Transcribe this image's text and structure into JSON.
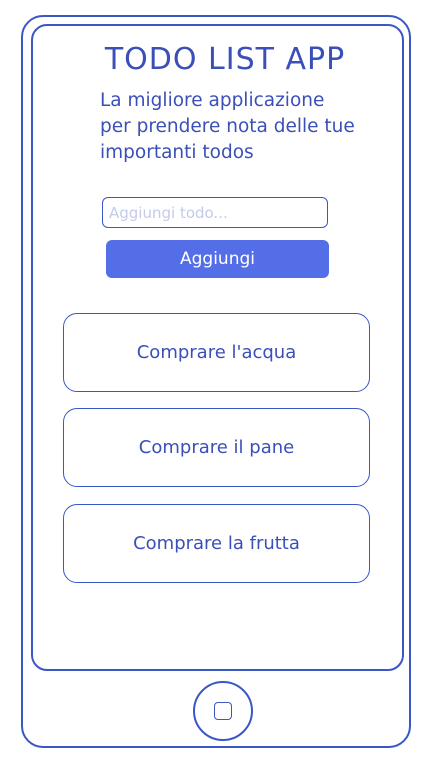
{
  "header": {
    "title": "TODO LIST APP",
    "subtitle": "La migliore applicazione per prendere nota delle tue importanti todos"
  },
  "form": {
    "input_value": "",
    "input_placeholder": "Aggiungi todo...",
    "add_label": "Aggiungi"
  },
  "todos": [
    {
      "label": "Comprare l'acqua"
    },
    {
      "label": "Comprare il pane"
    },
    {
      "label": "Comprare la frutta"
    }
  ],
  "device": {
    "home_button_icon": "home-square-icon"
  },
  "colors": {
    "accent": "#536ee6",
    "outline": "#3b57c4",
    "text": "#3b4fb8"
  }
}
